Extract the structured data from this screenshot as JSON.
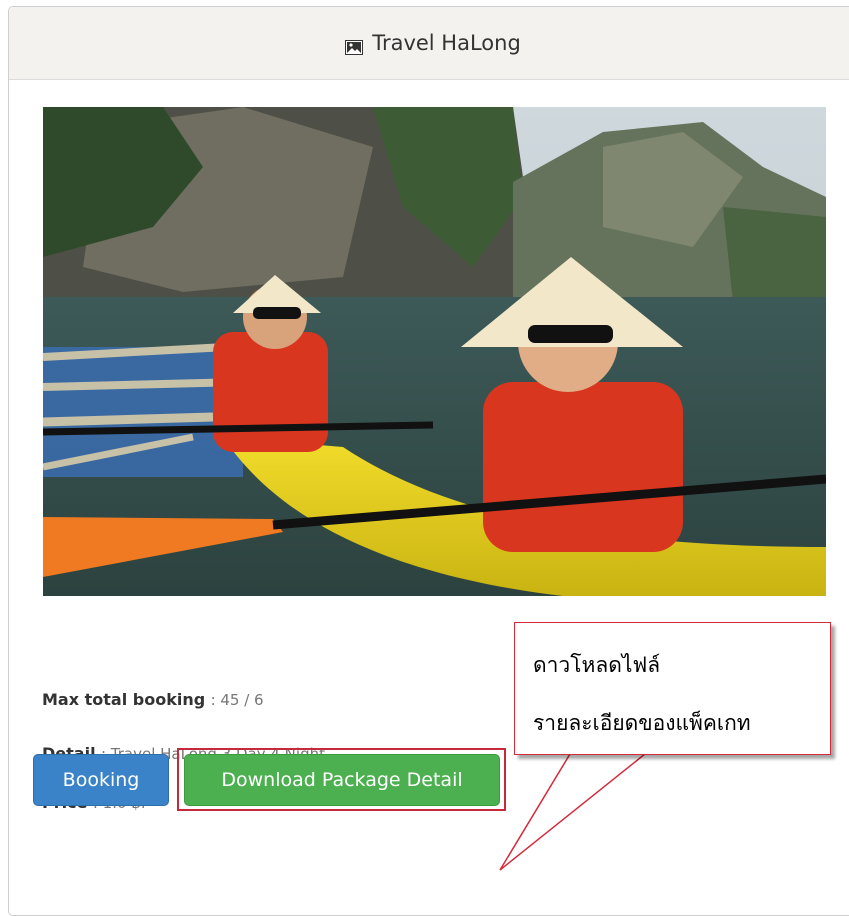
{
  "panel": {
    "title": "Travel HaLong"
  },
  "photo": {
    "alt": "Two tourists in red life jackets and conical hats paddling a yellow kayak in Ha Long Bay"
  },
  "package": {
    "max_booking_key": "Max total booking",
    "max_booking_value": ": 45 / 6",
    "detail_key": "Detail",
    "detail_value": ": Travel HaLong 3 Day 4 Night",
    "price_key": "Price",
    "price_value": ": 1.0 ฿."
  },
  "buttons": {
    "booking": "Booking",
    "download": "Download Package Detail"
  },
  "callout": {
    "line1": "ดาวโหลดไฟล์",
    "line2": "รายละเอียดของแพ็คเกท"
  },
  "colors": {
    "booking_button": "#3b83c9",
    "download_button": "#4cb050",
    "highlight_border": "#c62a3a"
  }
}
